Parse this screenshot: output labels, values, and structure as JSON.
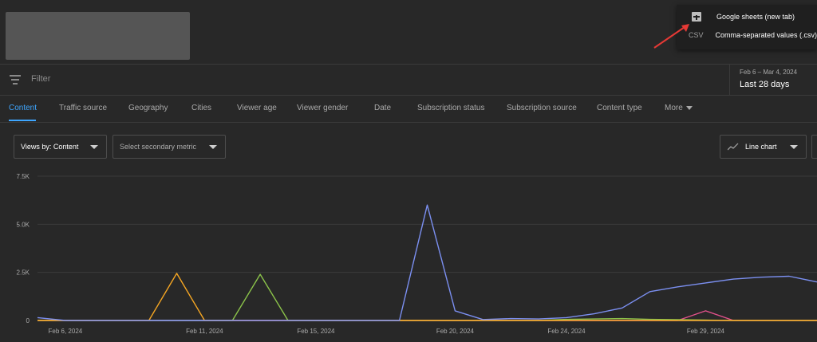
{
  "export_menu": {
    "items": [
      {
        "icon": "google-sheets-icon",
        "label": "Google sheets (new tab)"
      },
      {
        "icon": "csv-icon",
        "icon_text": "CSV",
        "label": "Comma-separated values (.csv)"
      }
    ]
  },
  "filter": {
    "placeholder": "Filter"
  },
  "date_range": {
    "range": "Feb 6 – Mar 4, 2024",
    "preset": "Last 28 days"
  },
  "tabs": [
    {
      "label": "Content",
      "active": true
    },
    {
      "label": "Traffic source"
    },
    {
      "label": "Geography"
    },
    {
      "label": "Cities"
    },
    {
      "label": "Viewer age"
    },
    {
      "label": "Viewer gender"
    },
    {
      "label": "Date"
    },
    {
      "label": "Subscription status"
    },
    {
      "label": "Subscription source"
    },
    {
      "label": "Content type"
    },
    {
      "label": "More"
    }
  ],
  "controls": {
    "primary_metric": "Views by: Content",
    "secondary_metric": "Select secondary metric",
    "chart_type": "Line chart"
  },
  "colors": {
    "accent": "#3ea6ff",
    "series_blue": "#7b8ff0",
    "series_orange": "#f5a623",
    "series_green": "#8bc34a",
    "series_pink": "#e0508a",
    "series_purple": "#b06ad8",
    "annotation_arrow": "#e53935"
  },
  "chart_data": {
    "type": "line",
    "x": [
      "Feb 5",
      "Feb 6",
      "Feb 7",
      "Feb 8",
      "Feb 9",
      "Feb 10",
      "Feb 11",
      "Feb 12",
      "Feb 13",
      "Feb 14",
      "Feb 15",
      "Feb 16",
      "Feb 17",
      "Feb 18",
      "Feb 19",
      "Feb 20",
      "Feb 21",
      "Feb 22",
      "Feb 23",
      "Feb 24",
      "Feb 25",
      "Feb 26",
      "Feb 27",
      "Feb 28",
      "Feb 29",
      "Mar 1",
      "Mar 2",
      "Mar 3",
      "Mar 4"
    ],
    "x_tick_labels": [
      "Feb 6, 2024",
      "Feb 11, 2024",
      "Feb 15, 2024",
      "Feb 20, 2024",
      "Feb 24, 2024",
      "Feb 29, 2024"
    ],
    "y_tick_labels": [
      "0",
      "2.5K",
      "5.0K",
      "7.5K"
    ],
    "ylim": [
      0,
      7500
    ],
    "grid": true,
    "series": [
      {
        "color": "#7b8ff0",
        "values": [
          150,
          0,
          0,
          0,
          0,
          0,
          0,
          0,
          0,
          0,
          0,
          0,
          0,
          0,
          6000,
          500,
          50,
          100,
          80,
          150,
          350,
          650,
          1500,
          1750,
          1950,
          2150,
          2250,
          2300,
          2000
        ]
      },
      {
        "color": "#f5a623",
        "values": [
          0,
          0,
          0,
          0,
          0,
          2450,
          0,
          0,
          0,
          0,
          0,
          0,
          0,
          0,
          0,
          0,
          0,
          0,
          0,
          0,
          0,
          0,
          0,
          0,
          0,
          0,
          0,
          0,
          0
        ]
      },
      {
        "color": "#8bc34a",
        "values": [
          0,
          0,
          0,
          0,
          0,
          0,
          0,
          0,
          2400,
          0,
          0,
          0,
          0,
          0,
          0,
          0,
          0,
          0,
          0,
          60,
          80,
          100,
          60,
          40,
          20,
          0,
          0,
          0,
          0
        ]
      },
      {
        "color": "#e0508a",
        "values": [
          0,
          0,
          0,
          0,
          0,
          0,
          0,
          0,
          0,
          0,
          0,
          0,
          0,
          0,
          0,
          0,
          0,
          0,
          0,
          0,
          0,
          0,
          0,
          0,
          500,
          0,
          0,
          0,
          0
        ]
      },
      {
        "color": "#b06ad8",
        "values": [
          0,
          0,
          0,
          0,
          0,
          0,
          0,
          0,
          0,
          0,
          0,
          0,
          0,
          0,
          0,
          0,
          0,
          0,
          0,
          0,
          0,
          0,
          0,
          0,
          0,
          0,
          0,
          0,
          0
        ]
      }
    ]
  }
}
